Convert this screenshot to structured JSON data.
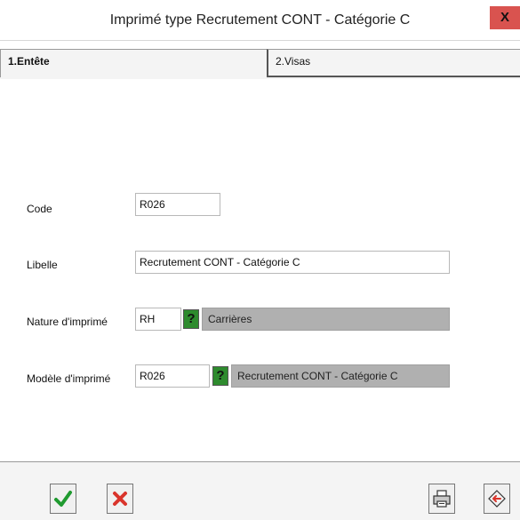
{
  "window": {
    "title": "Imprimé type Recrutement CONT - Catégorie C",
    "close_label": "X"
  },
  "tabs": [
    {
      "label": "1.Entête",
      "active": true
    },
    {
      "label": "2.Visas",
      "active": false
    }
  ],
  "form": {
    "code": {
      "label": "Code",
      "value": "R026"
    },
    "libelle": {
      "label": "Libelle",
      "value": "Recrutement CONT - Catégorie C"
    },
    "nature": {
      "label": "Nature d'imprimé",
      "value": "RH",
      "help": "?",
      "description": "Carrières"
    },
    "modele": {
      "label": "Modèle d'imprimé",
      "value": "R026",
      "help": "?",
      "description": "Recrutement CONT - Catégorie C"
    }
  },
  "toolbar": {
    "validate_icon": "checkmark-icon",
    "cancel_icon": "cross-icon",
    "print_icon": "printer-icon",
    "exit_icon": "exit-icon"
  },
  "colors": {
    "help": "#2e8b2e",
    "close": "#d9534f",
    "readonly": "#b0b0b0"
  }
}
